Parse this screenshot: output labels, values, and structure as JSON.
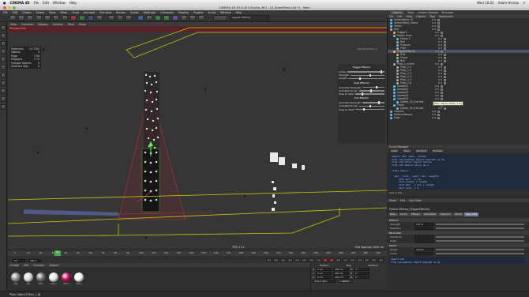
{
  "menubar": {
    "apple": "",
    "app": "CINEMA 4D",
    "items": [
      "File",
      "Edit",
      "Window",
      "Help"
    ],
    "clock": "Wed 10:22",
    "user": "Adam Heslop"
  },
  "window": {
    "title": "CINEMA 4D R14.025 Studio (RC) - [4_SpeedTest.c4d *] - Main"
  },
  "app_menu": [
    "File",
    "Edit",
    "Create",
    "Select",
    "Tools",
    "Mesh",
    "Snap",
    "Animate",
    "Simulate",
    "Render",
    "Sculpt",
    "MoGraph",
    "Character",
    "Pipeline",
    "Plugins",
    "Script",
    "Window",
    "Help"
  ],
  "layout_label": "Layout: Startup",
  "viewport": {
    "menu": [
      "View",
      "Cameras",
      "Display",
      "Options",
      "Filter",
      "Panel"
    ],
    "label": "Perspective",
    "stats": [
      {
        "k": "Projection",
        "v": "14 7202"
      },
      {
        "k": "Objects",
        "v": "4"
      },
      {
        "k": "Polys",
        "v": "5 08"
      },
      {
        "k": "Polygons",
        "v": "2 79"
      },
      {
        "k": "Triangle Objects",
        "v": "0"
      },
      {
        "k": "Selected Objs",
        "v": "0"
      }
    ],
    "hud": "Rebuilt Cache: 0",
    "fps": "FPS: 17.4",
    "grid": "Grid Spacing: 1000 cm"
  },
  "trigger_panel": {
    "title": "Trigger Effector",
    "groups": [
      {
        "label": "Trigger Effector",
        "rows": [
          "Active",
          "Strength",
          "Length"
        ],
        "levels": [
          0.9,
          0.55,
          0.3
        ]
      },
      {
        "label": "Push Effector",
        "rows": [
          "Animated Strength",
          "Animated Scale",
          "Ease to Start"
        ],
        "levels": [
          0.6,
          0.45,
          0.2
        ]
      },
      {
        "label": "Trail Effector",
        "rows": [
          "Animated Strength",
          "Animated Scale",
          "Ease to Start"
        ],
        "levels": [
          0.7,
          0.4,
          0.25
        ]
      }
    ]
  },
  "timeline": {
    "ticks": [
      "0",
      "10",
      "20",
      "30",
      "40",
      "50",
      "60",
      "70",
      "80",
      "90",
      "100",
      "110",
      "120",
      "130",
      "140",
      "150",
      "160",
      "170",
      "180",
      "190",
      "200",
      "210",
      "220",
      "230",
      "240",
      "250",
      "260",
      "270",
      "280",
      "290"
    ],
    "current": "52",
    "start_field": "0 F",
    "end_field": "300 F",
    "frame_display": "52 F"
  },
  "materials": {
    "menu": [
      "Create",
      "Edit",
      "Function",
      "Texture"
    ],
    "items": [
      {
        "name": "Mat",
        "color": "#8a8a8a"
      },
      {
        "name": "Mat",
        "color": "#d8d8d8"
      },
      {
        "name": "Mat.1",
        "color": "#6a6a6a"
      },
      {
        "name": "Mat.2",
        "color": "#e6e6e6"
      },
      {
        "name": "Mat.3",
        "color": "#c8005a"
      },
      {
        "name": "Mat.4",
        "color": "#f2f2f2"
      }
    ]
  },
  "coordinates": {
    "headers": [
      "Position",
      "Size",
      "Rotation"
    ],
    "rows": [
      {
        "axis": "X",
        "pos": "0 cm",
        "size": "200 cm",
        "rot_label": "H",
        "rot": "0 °"
      },
      {
        "axis": "Y",
        "pos": "0 cm",
        "size": "200 cm",
        "rot_label": "P",
        "rot": "0 °"
      },
      {
        "axis": "Z",
        "pos": "0 cm",
        "size": "200 cm",
        "rot_label": "B",
        "rot": "0 °"
      }
    ],
    "mode": "Object (Rel)",
    "apply": "Apply"
  },
  "statusbar": {
    "text": "Plain Object [Plain_1.8]"
  },
  "object_manager": {
    "tabs": [
      "Objects",
      "Takes",
      "Content Browser",
      "Structure"
    ],
    "active_tab": "Objects",
    "menu": [
      "File",
      "Edit",
      "View",
      "Objects",
      "Tags",
      "Bookmarks"
    ],
    "rows": [
      {
        "indent": 0,
        "name": "Vertex/Move_01",
        "color": "#58c4ff",
        "sel": false
      },
      {
        "indent": 0,
        "name": "Vertex/Move_Scene",
        "color": "#58c4ff",
        "sel": false
      },
      {
        "indent": 0,
        "name": "Vertex",
        "color": "#58c4ff",
        "sel": false
      },
      {
        "indent": 0,
        "name": "Null",
        "color": "#aaaaaa",
        "sel": false
      },
      {
        "indent": 1,
        "name": "Trigger1",
        "color": "#ffb040",
        "sel": false
      },
      {
        "indent": 1,
        "name": "Matrix Lines",
        "color": "#58c4ff",
        "sel": false
      },
      {
        "indent": 2,
        "name": "Matrix 1",
        "color": "#58c4ff",
        "sel": false
      },
      {
        "indent": 2,
        "name": "Null",
        "color": "#aaaaaa",
        "sel": false
      },
      {
        "indent": 2,
        "name": "Fracture",
        "color": "#58c4ff",
        "sel": false
      },
      {
        "indent": 2,
        "name": "Plain",
        "color": "#aaaaaa",
        "sel": false
      },
      {
        "indent": 1,
        "name": "TriggerEffector",
        "color": "#ffb040",
        "sel": true
      },
      {
        "indent": 2,
        "name": "Trail",
        "color": "#ffb040",
        "sel": false
      },
      {
        "indent": 2,
        "name": "Tracer",
        "color": "#58c4ff",
        "sel": false
      },
      {
        "indent": 2,
        "name": "Null",
        "color": "#aaaaaa",
        "sel": false
      },
      {
        "indent": 1,
        "name": "Plain_1_scene",
        "color": "#aaaaaa",
        "sel": false
      },
      {
        "indent": 2,
        "name": "Plain_1.1",
        "color": "#aaaaaa",
        "sel": false
      },
      {
        "indent": 2,
        "name": "Plain_1.2",
        "color": "#aaaaaa",
        "sel": false
      },
      {
        "indent": 2,
        "name": "Plain_1.3",
        "color": "#aaaaaa",
        "sel": false
      },
      {
        "indent": 2,
        "name": "Plain_1.4",
        "color": "#aaaaaa",
        "sel": false
      },
      {
        "indent": 2,
        "name": "Plain_1.5",
        "color": "#aaaaaa",
        "sel": false
      },
      {
        "indent": 2,
        "name": "Plain_1.6",
        "color": "#aaaaaa",
        "sel": false
      },
      {
        "indent": 1,
        "name": "Sweep01",
        "color": "#58c4ff",
        "sel": false
      },
      {
        "indent": 1,
        "name": "Sweep02",
        "color": "#58c4ff",
        "sel": false
      },
      {
        "indent": 1,
        "name": "Sweep03",
        "color": "#58c4ff",
        "sel": false
      },
      {
        "indent": 1,
        "name": "Sweep04",
        "color": "#58c4ff",
        "sel": false
      },
      {
        "indent": 1,
        "name": "Sweep05",
        "color": "#58c4ff",
        "sel": false
      },
      {
        "indent": 2,
        "name": "Sweep_05_Extrude",
        "color": "#58c4ff",
        "sel": false
      },
      {
        "indent": 1,
        "name": "Plane",
        "color": "#58c4ff",
        "sel": false
      },
      {
        "indent": 2,
        "name": "Sweep_06_Extrude",
        "color": "#58c4ff",
        "sel": false
      },
      {
        "indent": 0,
        "name": "Camera",
        "color": "#aaaaaa",
        "sel": false
      },
      {
        "indent": 0,
        "name": "Vertical Beams",
        "color": "#58c4ff",
        "sel": false
      },
      {
        "indent": 0,
        "name": "Floor",
        "color": "#58c4ff",
        "sel": false
      }
    ],
    "tooltip": "Plain Object [Plain_1.8]"
  },
  "script_editor": {
    "title": "Script Manager",
    "buttons": [
      "Load",
      "Save",
      "Shortcut",
      "Execute"
    ],
    "lines": [
      "import c4d, math, random",
      "from c4d.modules import mograph as mo",
      "from c4d.utils import SinCos",
      "from c4d import utils as u",
      "",
      "class ease():",
      "",
      "  def __init__(self, min, length):",
      "     self.min   = min",
      "     self.length = length",
      "     self.max   = min + length",
      "     self.lerp  = 0"
    ],
    "status": "Line 1, Pos"
  },
  "attribute_manager": {
    "menu": [
      "Mode",
      "Edit",
      "User Data"
    ],
    "title": "Python Effector [TriggerEffector]",
    "tabs": [
      "Basic",
      "Coord.",
      "Effector",
      "Parameter",
      "Deformer",
      "Falloff",
      "User Data"
    ],
    "active_tab": "User Data",
    "sections": [
      {
        "label": "Effector",
        "rows": [
          {
            "label": "Strength",
            "value": "100 %"
          },
          {
            "label": "Selection",
            "value": ""
          }
        ]
      },
      {
        "label": "Parameter",
        "rows": [
          {
            "label": "Transform",
            "value": ""
          },
          {
            "label": "Scale",
            "value": ""
          }
        ]
      },
      {
        "label": "Falloff",
        "rows": [
          {
            "label": "Shape",
            "value": "Infinite"
          },
          {
            "label": "Invert",
            "value": ""
          }
        ]
      }
    ],
    "code_lines": [
      "import c4d",
      "from c4d.modules import mograph as mo"
    ]
  },
  "colors": {
    "viewport_bg": "#363636",
    "accent_orange": "#ff9a4d",
    "selection_blue": "#4b5766",
    "wire_yellow": "#c8c800",
    "wire_red": "#c83040"
  }
}
